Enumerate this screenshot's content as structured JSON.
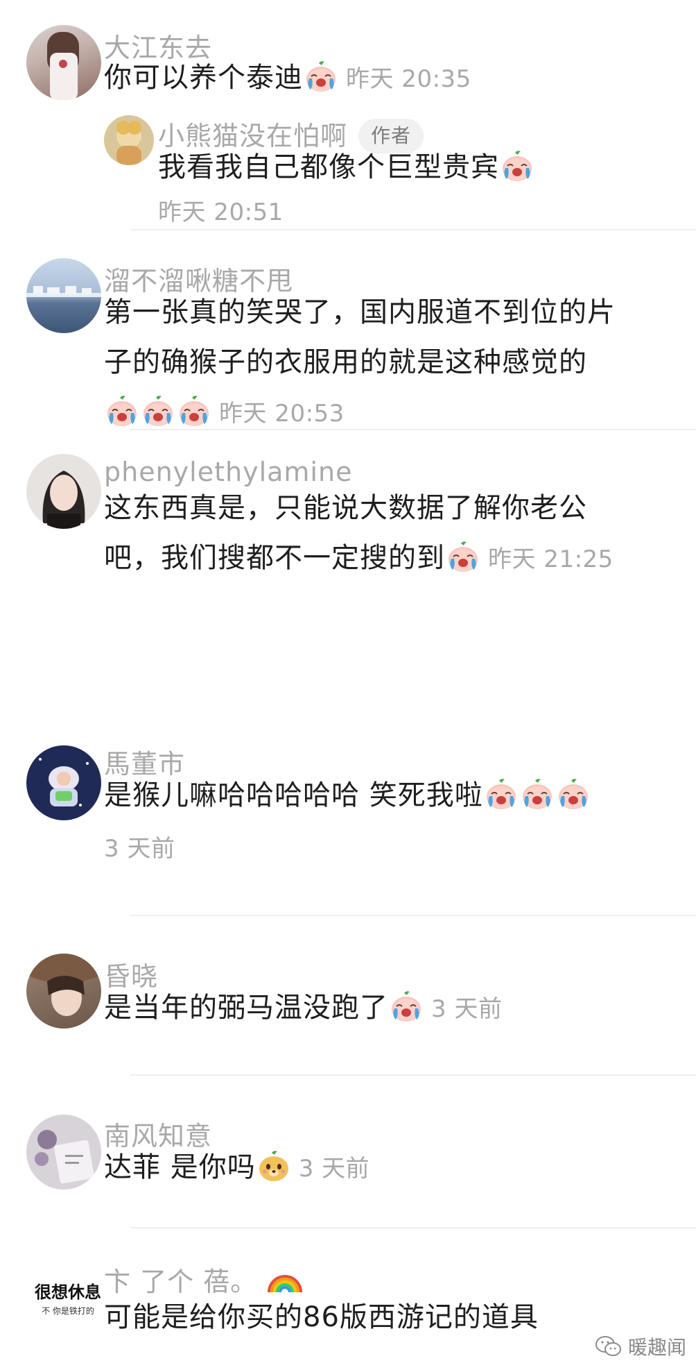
{
  "comments": [
    {
      "name": "大江东去",
      "text": "你可以养个泰迪",
      "emojis": [
        "cry-emoji"
      ],
      "time": "昨天 20:35",
      "reply": {
        "name": "小熊猫没在怕啊",
        "badge": "作者",
        "text": "我看我自己都像个巨型贵宾",
        "emojis": [
          "cry-emoji"
        ],
        "time": "昨天 20:51"
      }
    },
    {
      "name": "溜不溜啾糖不甩",
      "line1": "第一张真的笑哭了，国内服道不到位的片",
      "line2": "子的确猴子的衣服用的就是这种感觉的",
      "emojis": [
        "cry-emoji",
        "cry-emoji",
        "cry-emoji"
      ],
      "time": "昨天 20:53"
    },
    {
      "name": "phenylethylamine",
      "line1": "这东西真是，只能说大数据了解你老公",
      "line2": "吧，我们搜都不一定搜的到",
      "emojis": [
        "cry-emoji"
      ],
      "time": "昨天 21:25"
    },
    {
      "name": "馬董市",
      "text": "是猴儿嘛哈哈哈哈哈 笑死我啦",
      "emojis": [
        "cry-emoji",
        "cry-emoji",
        "cry-emoji"
      ],
      "time": "3 天前"
    },
    {
      "name": "昏晓",
      "text": "是当年的弼马温没跑了",
      "emojis": [
        "cry-emoji"
      ],
      "time": "3 天前"
    },
    {
      "name": "南风知意",
      "text": "达菲 是你吗",
      "emojis": [
        "bear-emoji"
      ],
      "time": "3 天前"
    },
    {
      "name": "卞 了个 蓓。",
      "name_emoji": "rainbow-emoji",
      "text": "可能是给你买的86版西游记的道具",
      "avatar_text": {
        "big": "很想休息",
        "small": "不 你是铁打的"
      }
    }
  ],
  "watermark": {
    "label": "暖趣闻",
    "icon": "wechat-icon"
  },
  "colors": {
    "name": "#a8a8a8",
    "text": "#1e1e1e",
    "time": "#a8a8a8",
    "divider": "#efefef",
    "badge_bg": "#f1f1f1"
  }
}
